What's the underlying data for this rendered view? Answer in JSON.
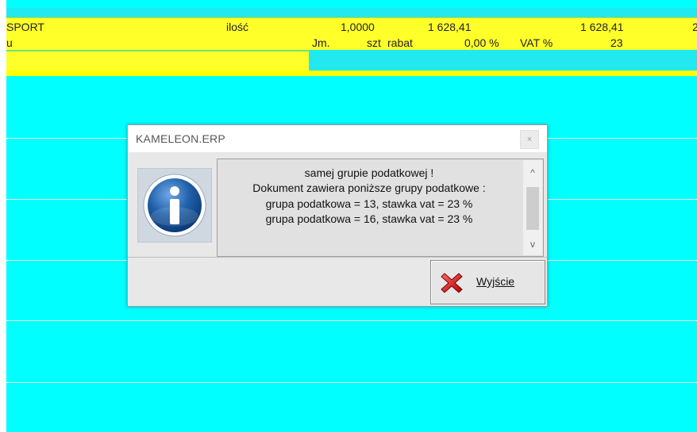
{
  "grid": {
    "row1": {
      "name": "SPORT",
      "qty_label": "ilość",
      "qty": "1,0000",
      "price": "1 628,41",
      "value": "1 628,41",
      "extra": "2"
    },
    "row2": {
      "name": "u",
      "unit_label": "Jm.",
      "unit": "szt",
      "discount_label": "rabat",
      "discount": "0,00 %",
      "vat_label": "VAT %",
      "vat": "23"
    }
  },
  "dialog": {
    "title": "KAMELEON.ERP",
    "close": "×",
    "info_icon": "info-icon",
    "message_lines": [
      "samej grupie podatkowej !",
      "Dokument zawiera poniższe grupy podatkowe :",
      "grupa podatkowa = 13, stawka vat = 23 %",
      "grupa podatkowa = 16, stawka vat = 23 %"
    ],
    "scroll_up": "^",
    "scroll_down": "v",
    "exit_button": {
      "label": "Wyjście",
      "icon": "red-x-icon"
    }
  },
  "colors": {
    "background": "#00ffff",
    "row_highlight": "#ffff2a",
    "dialog": "#e8e8e8",
    "info_blue": "#1f5fa8",
    "exit_red": "#e02020"
  }
}
